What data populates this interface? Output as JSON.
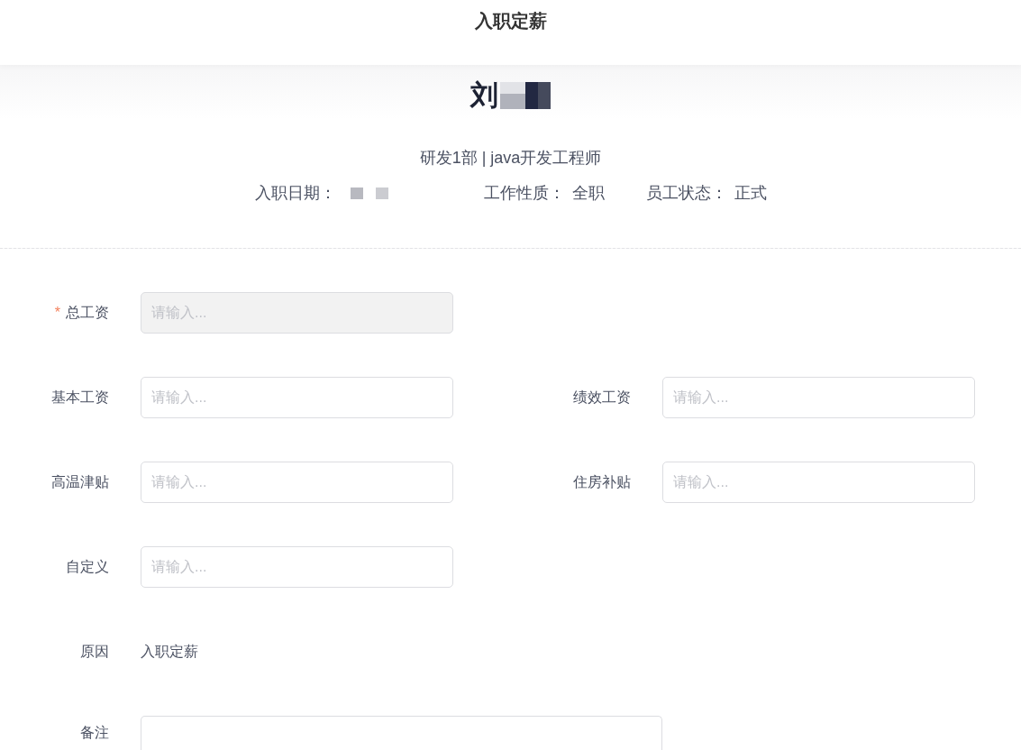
{
  "header": {
    "title": "入职定薪"
  },
  "employee": {
    "name": "刘",
    "name_redacted": true,
    "department_title": "研发1部 | java开发工程师",
    "info": [
      {
        "label": "入职日期：",
        "value_redacted": true
      },
      {
        "label": "工作性质：",
        "value": "全职"
      },
      {
        "label": "员工状态：",
        "value": "正式"
      }
    ]
  },
  "form": {
    "rows": [
      [
        {
          "kind": "input",
          "label": "总工资",
          "required_mark": "*",
          "disabled": true,
          "placeholder": "请输入..."
        }
      ],
      [
        {
          "kind": "input",
          "label": "基本工资",
          "disabled": false,
          "placeholder": "请输入..."
        },
        {
          "kind": "input",
          "label": "绩效工资",
          "disabled": false,
          "placeholder": "请输入..."
        }
      ],
      [
        {
          "kind": "input",
          "label": "高温津贴",
          "disabled": false,
          "placeholder": "请输入..."
        },
        {
          "kind": "input",
          "label": "住房补贴",
          "disabled": false,
          "placeholder": "请输入..."
        }
      ],
      [
        {
          "kind": "input",
          "label": "自定义",
          "disabled": false,
          "placeholder": "请输入..."
        }
      ],
      [
        {
          "kind": "text",
          "label": "原因",
          "value": "入职定薪"
        }
      ],
      [
        {
          "kind": "textarea",
          "label": "备注"
        }
      ]
    ]
  }
}
